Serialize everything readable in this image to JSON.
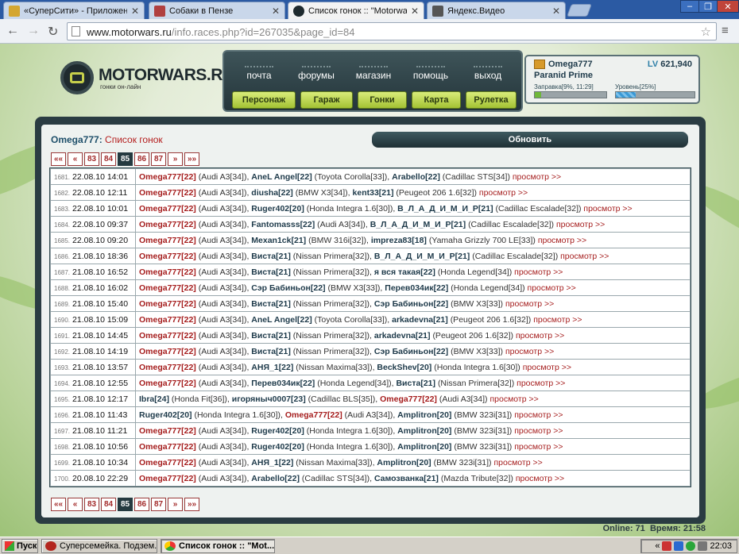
{
  "browser": {
    "tabs": [
      {
        "label": "«СуперСити» - Приложени",
        "active": false
      },
      {
        "label": "Собаки в Пензе",
        "active": false
      },
      {
        "label": "Список гонок :: \"Motorwars",
        "active": true
      },
      {
        "label": "Яндекс.Видео",
        "active": false
      }
    ],
    "url_host": "www.motorwars.ru",
    "url_path": "/info.races.php?id=267035&page_id=84"
  },
  "site": {
    "logo": {
      "name": "MOTORWARS.RU",
      "tagline": "гонки он-лайн"
    },
    "top_links": [
      "почта",
      "форумы",
      "магазин",
      "помощь",
      "выход"
    ],
    "section_buttons": [
      "Персонаж",
      "Гараж",
      "Гонки",
      "Карта",
      "Рулетка"
    ],
    "user": {
      "name": "Omega777",
      "level_prefix": "LV",
      "level_value": "621,940",
      "car": "Paranid Prime",
      "fuel_label": "Заправка[9%, 11:29]",
      "fuel_fraction": 0.09,
      "level_label": "Уровень[25%]",
      "level_fraction": 0.25
    },
    "page": {
      "user": "Omega777",
      "title_suffix": "Список гонок",
      "refresh_label": "Обновить"
    },
    "pager": [
      "««",
      "«",
      "83",
      "84",
      "85",
      "86",
      "87",
      "»",
      "»»"
    ],
    "pager_current": "85",
    "races": [
      {
        "num": "1681.",
        "date": "22.08.10 14:01",
        "entries": [
          [
            "Omega777",
            "[22]",
            "(Audi A3[34])"
          ],
          [
            "AneL Angel",
            "[22]",
            "(Toyota Corolla[33])"
          ],
          [
            "Arabello",
            "[22]",
            "(Cadillac STS[34])"
          ]
        ]
      },
      {
        "num": "1682.",
        "date": "22.08.10 12:11",
        "entries": [
          [
            "Omega777",
            "[22]",
            "(Audi A3[34])"
          ],
          [
            "diusha",
            "[22]",
            "(BMW X3[34])"
          ],
          [
            "kent33",
            "[21]",
            "(Peugeot 206 1.6[32])"
          ]
        ]
      },
      {
        "num": "1683.",
        "date": "22.08.10 10:01",
        "entries": [
          [
            "Omega777",
            "[22]",
            "(Audi A3[34])"
          ],
          [
            "Ruger402",
            "[20]",
            "(Honda Integra 1.6[30])"
          ],
          [
            "В_Л_А_Д_И_М_И_Р",
            "[21]",
            "(Cadillac Escalade[32])"
          ]
        ]
      },
      {
        "num": "1684.",
        "date": "22.08.10 09:37",
        "entries": [
          [
            "Omega777",
            "[22]",
            "(Audi A3[34])"
          ],
          [
            "Fantomasss",
            "[22]",
            "(Audi A3[34])"
          ],
          [
            "В_Л_А_Д_И_М_И_Р",
            "[21]",
            "(Cadillac Escalade[32])"
          ]
        ]
      },
      {
        "num": "1685.",
        "date": "22.08.10 09:20",
        "entries": [
          [
            "Omega777",
            "[22]",
            "(Audi A3[34])"
          ],
          [
            "Mexan1ck",
            "[21]",
            "(BMW 316i[32])"
          ],
          [
            "impreza83",
            "[18]",
            "(Yamaha Grizzly 700 LE[33])"
          ]
        ]
      },
      {
        "num": "1686.",
        "date": "21.08.10 18:36",
        "entries": [
          [
            "Omega777",
            "[22]",
            "(Audi A3[34])"
          ],
          [
            "Виста",
            "[21]",
            "(Nissan Primera[32])"
          ],
          [
            "В_Л_А_Д_И_М_И_Р",
            "[21]",
            "(Cadillac Escalade[32])"
          ]
        ]
      },
      {
        "num": "1687.",
        "date": "21.08.10 16:52",
        "entries": [
          [
            "Omega777",
            "[22]",
            "(Audi A3[34])"
          ],
          [
            "Виста",
            "[21]",
            "(Nissan Primera[32])"
          ],
          [
            "я вся такая",
            "[22]",
            "(Honda Legend[34])"
          ]
        ]
      },
      {
        "num": "1688.",
        "date": "21.08.10 16:02",
        "entries": [
          [
            "Omega777",
            "[22]",
            "(Audi A3[34])"
          ],
          [
            "Сэр Бабиньон",
            "[22]",
            "(BMW X3[33])"
          ],
          [
            "Перев034ик",
            "[22]",
            "(Honda Legend[34])"
          ]
        ]
      },
      {
        "num": "1689.",
        "date": "21.08.10 15:40",
        "entries": [
          [
            "Omega777",
            "[22]",
            "(Audi A3[34])"
          ],
          [
            "Виста",
            "[21]",
            "(Nissan Primera[32])"
          ],
          [
            "Сэр Бабиньон",
            "[22]",
            "(BMW X3[33])"
          ]
        ]
      },
      {
        "num": "1690.",
        "date": "21.08.10 15:09",
        "entries": [
          [
            "Omega777",
            "[22]",
            "(Audi A3[34])"
          ],
          [
            "AneL Angel",
            "[22]",
            "(Toyota Corolla[33])"
          ],
          [
            "arkadevna",
            "[21]",
            "(Peugeot 206 1.6[32])"
          ]
        ]
      },
      {
        "num": "1691.",
        "date": "21.08.10 14:45",
        "entries": [
          [
            "Omega777",
            "[22]",
            "(Audi A3[34])"
          ],
          [
            "Виста",
            "[21]",
            "(Nissan Primera[32])"
          ],
          [
            "arkadevna",
            "[21]",
            "(Peugeot 206 1.6[32])"
          ]
        ]
      },
      {
        "num": "1692.",
        "date": "21.08.10 14:19",
        "entries": [
          [
            "Omega777",
            "[22]",
            "(Audi A3[34])"
          ],
          [
            "Виста",
            "[21]",
            "(Nissan Primera[32])"
          ],
          [
            "Сэр Бабиньон",
            "[22]",
            "(BMW X3[33])"
          ]
        ]
      },
      {
        "num": "1693.",
        "date": "21.08.10 13:57",
        "entries": [
          [
            "Omega777",
            "[22]",
            "(Audi A3[34])"
          ],
          [
            "АНЯ_1",
            "[22]",
            "(Nissan Maxima[33])"
          ],
          [
            "BeckShev",
            "[20]",
            "(Honda Integra 1.6[30])"
          ]
        ]
      },
      {
        "num": "1694.",
        "date": "21.08.10 12:55",
        "entries": [
          [
            "Omega777",
            "[22]",
            "(Audi A3[34])"
          ],
          [
            "Перев034ик",
            "[22]",
            "(Honda Legend[34])"
          ],
          [
            "Виста",
            "[21]",
            "(Nissan Primera[32])"
          ]
        ]
      },
      {
        "num": "1695.",
        "date": "21.08.10 12:17",
        "entries": [
          [
            "Ibra",
            "[24]",
            "(Honda Fit[36])"
          ],
          [
            "игоряныч0007",
            "[23]",
            "(Cadillac BLS[35])"
          ],
          [
            "Omega777",
            "[22]",
            "(Audi A3[34])"
          ]
        ]
      },
      {
        "num": "1696.",
        "date": "21.08.10 11:43",
        "entries": [
          [
            "Ruger402",
            "[20]",
            "(Honda Integra 1.6[30])"
          ],
          [
            "Omega777",
            "[22]",
            "(Audi A3[34])"
          ],
          [
            "Amplitron",
            "[20]",
            "(BMW 323i[31])"
          ]
        ]
      },
      {
        "num": "1697.",
        "date": "21.08.10 11:21",
        "entries": [
          [
            "Omega777",
            "[22]",
            "(Audi A3[34])"
          ],
          [
            "Ruger402",
            "[20]",
            "(Honda Integra 1.6[30])"
          ],
          [
            "Amplitron",
            "[20]",
            "(BMW 323i[31])"
          ]
        ]
      },
      {
        "num": "1698.",
        "date": "21.08.10 10:56",
        "entries": [
          [
            "Omega777",
            "[22]",
            "(Audi A3[34])"
          ],
          [
            "Ruger402",
            "[20]",
            "(Honda Integra 1.6[30])"
          ],
          [
            "Amplitron",
            "[20]",
            "(BMW 323i[31])"
          ]
        ]
      },
      {
        "num": "1699.",
        "date": "21.08.10 10:34",
        "entries": [
          [
            "Omega777",
            "[22]",
            "(Audi A3[34])"
          ],
          [
            "АНЯ_1",
            "[22]",
            "(Nissan Maxima[33])"
          ],
          [
            "Amplitron",
            "[20]",
            "(BMW 323i[31])"
          ]
        ]
      },
      {
        "num": "1700.",
        "date": "20.08.10 22:29",
        "entries": [
          [
            "Omega777",
            "[22]",
            "(Audi A3[34])"
          ],
          [
            "Arabello",
            "[22]",
            "(Cadillac STS[34])"
          ],
          [
            "Самозванка",
            "[21]",
            "(Mazda Tribute[32])"
          ]
        ]
      }
    ],
    "view_label": "просмотр >>",
    "status": {
      "online_label": "Online:",
      "online_value": "71",
      "time_label": "Время:",
      "time_value": "21:58"
    }
  },
  "taskbar": {
    "start_label": "Пуск",
    "tasks": [
      {
        "label": "Суперсемейка. Подзем...",
        "active": false
      },
      {
        "label": "Список гонок :: \"Mot...",
        "active": true
      }
    ],
    "clock": "22:03"
  },
  "colors": {
    "player_highlight": "#a51d1d",
    "player_name": "#1e3a4a",
    "panel_dark": "#2a3c42",
    "button_green": "#b6d33e"
  }
}
